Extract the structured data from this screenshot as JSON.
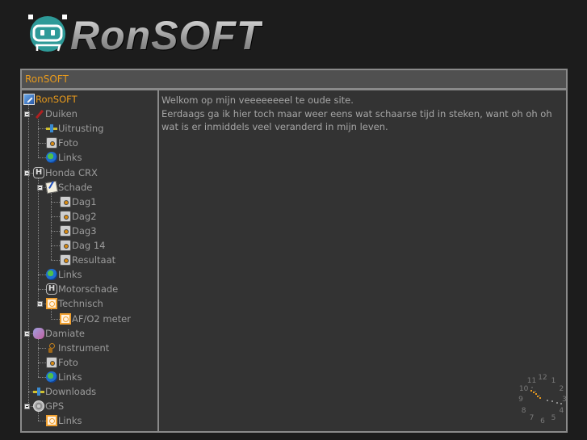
{
  "logo": {
    "text": "RonSOFT",
    "badge_color": "#2e9a98"
  },
  "frame": {
    "title": "RonSOFT",
    "title_color": "#e89a1c"
  },
  "tree": [
    {
      "label": "RonSOFT",
      "icon": "root-pencil-icon",
      "level": 0,
      "root": true
    },
    {
      "label": "Duiken",
      "icon": "dive-icon",
      "level": 1,
      "expanded": true
    },
    {
      "label": "Uitrusting",
      "icon": "equipment-icon",
      "level": 2
    },
    {
      "label": "Foto",
      "icon": "camera-icon",
      "level": 2
    },
    {
      "label": "Links",
      "icon": "globe-icon",
      "level": 2
    },
    {
      "label": "Honda CRX",
      "icon": "honda-icon",
      "level": 1,
      "expanded": true
    },
    {
      "label": "Schade",
      "icon": "damage-report-icon",
      "level": 2,
      "expanded": true
    },
    {
      "label": "Dag1",
      "icon": "camera-icon",
      "level": 3
    },
    {
      "label": "Dag2",
      "icon": "camera-icon",
      "level": 3
    },
    {
      "label": "Dag3",
      "icon": "camera-icon",
      "level": 3
    },
    {
      "label": "Dag 14",
      "icon": "camera-icon",
      "level": 3
    },
    {
      "label": "Resultaat",
      "icon": "camera-icon",
      "level": 3
    },
    {
      "label": "Links",
      "icon": "globe-icon",
      "level": 2
    },
    {
      "label": "Motorschade",
      "icon": "honda-icon",
      "level": 2
    },
    {
      "label": "Technisch",
      "icon": "orange-page-icon",
      "level": 2,
      "expanded": true
    },
    {
      "label": "AF/O2 meter",
      "icon": "orange-page-icon",
      "level": 3
    },
    {
      "label": "Damiate",
      "icon": "damiate-icon",
      "level": 1,
      "expanded": true
    },
    {
      "label": "Instrument",
      "icon": "instrument-icon",
      "level": 2
    },
    {
      "label": "Foto",
      "icon": "camera-icon",
      "level": 2
    },
    {
      "label": "Links",
      "icon": "globe-icon",
      "level": 2
    },
    {
      "label": "Downloads",
      "icon": "equipment-icon",
      "level": 1
    },
    {
      "label": "GPS",
      "icon": "gps-icon",
      "level": 1,
      "expanded": true
    },
    {
      "label": "Links",
      "icon": "orange-page-icon",
      "level": 2
    }
  ],
  "content": {
    "lines": [
      "Welkom op mijn veeeeeeeel te oude site.",
      "Eerdaags ga ik hier toch maar weer eens wat schaarse tijd in steken, want oh oh oh wat is er inmiddels veel veranderd in mijn leven."
    ]
  },
  "clock": {
    "numerals": [
      "12",
      "1",
      "2",
      "3",
      "4",
      "5",
      "6",
      "7",
      "8",
      "9",
      "10",
      "11"
    ],
    "time_approx": "10:17"
  }
}
